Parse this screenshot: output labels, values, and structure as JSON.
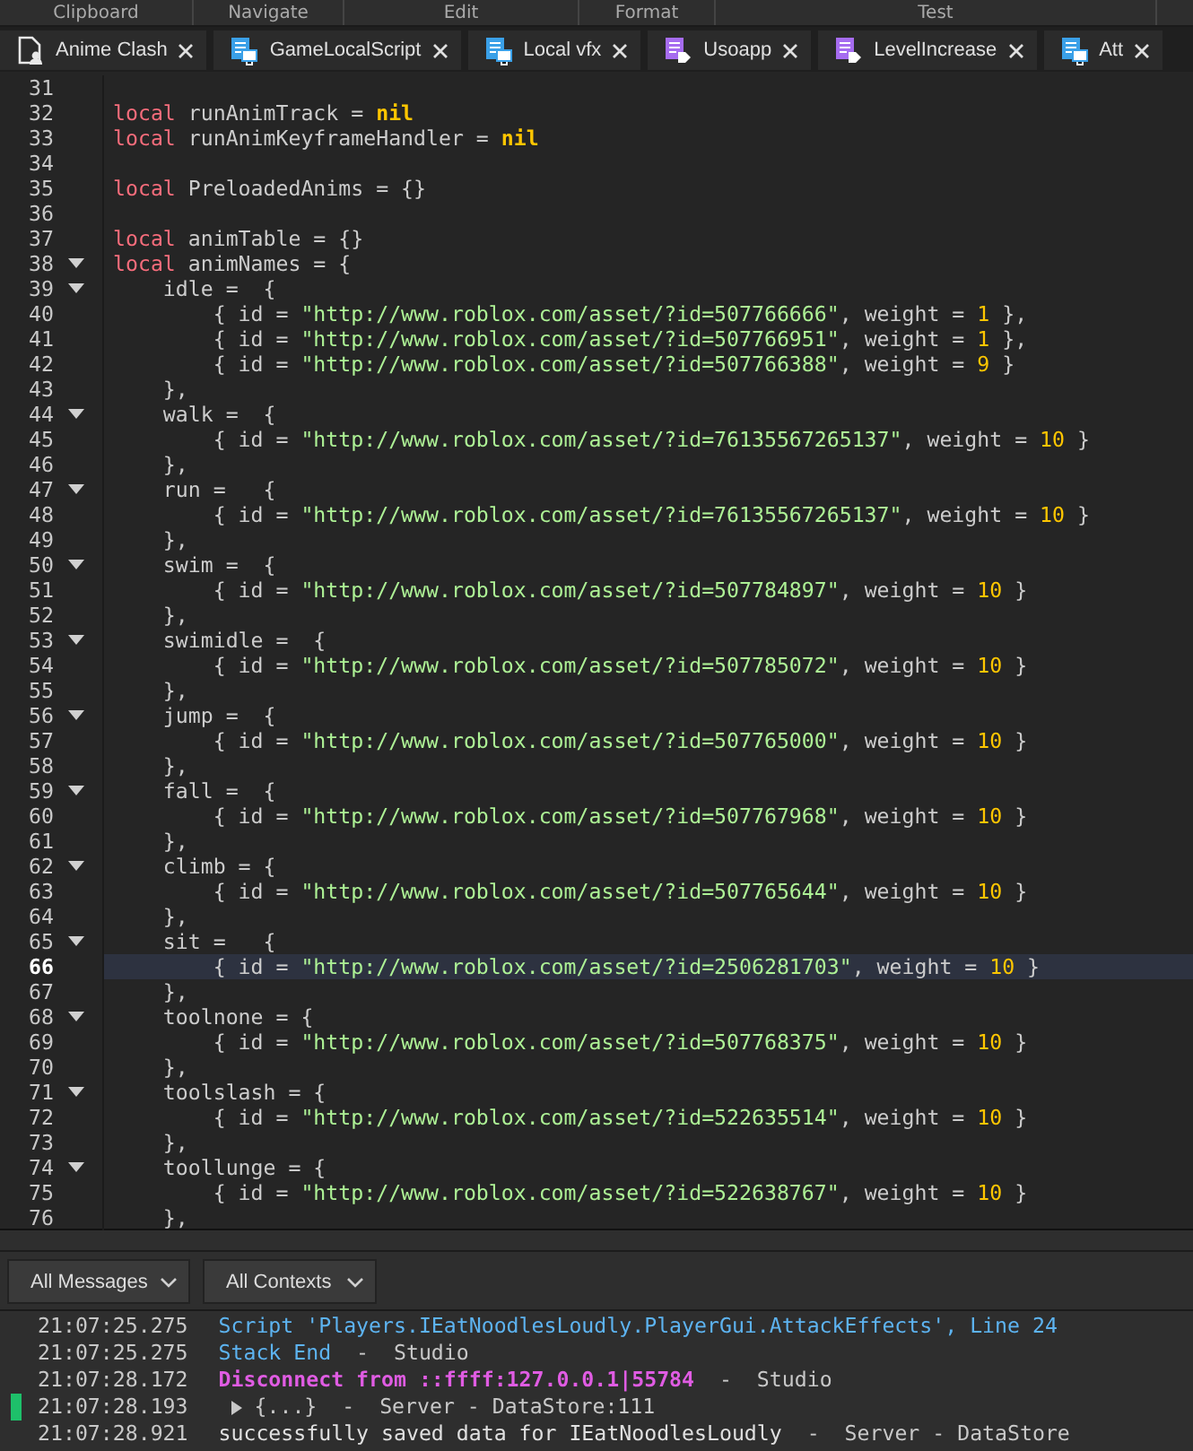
{
  "ribbon": [
    {
      "label": "Clipboard"
    },
    {
      "label": "Navigate"
    },
    {
      "label": "Edit"
    },
    {
      "label": "Format"
    },
    {
      "label": "Test"
    }
  ],
  "tabs": [
    {
      "label": "Anime Clash",
      "kind": "script"
    },
    {
      "label": "GameLocalScript",
      "kind": "local-script"
    },
    {
      "label": "Local vfx",
      "kind": "local-script"
    },
    {
      "label": "Usoapp",
      "kind": "module-script"
    },
    {
      "label": "LevelIncrease",
      "kind": "module-script"
    },
    {
      "label": "Att",
      "kind": "local-script"
    }
  ],
  "editor": {
    "lines": [
      {
        "number": "31",
        "fold": false,
        "current": false
      },
      {
        "number": "32",
        "fold": false,
        "current": false,
        "tokens": [
          {
            "kind": "keyword",
            "text": "local"
          },
          {
            "kind": "plain",
            "text": " runAnimTrack = "
          },
          {
            "kind": "nil",
            "text": "nil"
          }
        ]
      },
      {
        "number": "33",
        "fold": false,
        "current": false,
        "tokens": [
          {
            "kind": "keyword",
            "text": "local"
          },
          {
            "kind": "plain",
            "text": " runAnimKeyframeHandler = "
          },
          {
            "kind": "nil",
            "text": "nil"
          }
        ]
      },
      {
        "number": "34",
        "fold": false,
        "current": false
      },
      {
        "number": "35",
        "fold": false,
        "current": false,
        "tokens": [
          {
            "kind": "keyword",
            "text": "local"
          },
          {
            "kind": "plain",
            "text": " PreloadedAnims = {}"
          }
        ]
      },
      {
        "number": "36",
        "fold": false,
        "current": false
      },
      {
        "number": "37",
        "fold": false,
        "current": false,
        "tokens": [
          {
            "kind": "keyword",
            "text": "local"
          },
          {
            "kind": "plain",
            "text": " animTable = {}"
          }
        ]
      },
      {
        "number": "38",
        "fold": true,
        "current": false,
        "tokens": [
          {
            "kind": "keyword",
            "text": "local"
          },
          {
            "kind": "plain",
            "text": " animNames = {"
          }
        ]
      },
      {
        "number": "39",
        "fold": true,
        "current": false,
        "tokens": [
          {
            "kind": "plain",
            "text": "    idle =  {"
          }
        ]
      },
      {
        "number": "40",
        "fold": false,
        "current": false,
        "tokens": [
          {
            "kind": "plain",
            "text": "        { id = "
          },
          {
            "kind": "string",
            "text": "\"http://www.roblox.com/asset/?id=507766666\""
          },
          {
            "kind": "plain",
            "text": ", weight = "
          },
          {
            "kind": "number",
            "text": "1"
          },
          {
            "kind": "plain",
            "text": " },"
          }
        ]
      },
      {
        "number": "41",
        "fold": false,
        "current": false,
        "tokens": [
          {
            "kind": "plain",
            "text": "        { id = "
          },
          {
            "kind": "string",
            "text": "\"http://www.roblox.com/asset/?id=507766951\""
          },
          {
            "kind": "plain",
            "text": ", weight = "
          },
          {
            "kind": "number",
            "text": "1"
          },
          {
            "kind": "plain",
            "text": " },"
          }
        ]
      },
      {
        "number": "42",
        "fold": false,
        "current": false,
        "tokens": [
          {
            "kind": "plain",
            "text": "        { id = "
          },
          {
            "kind": "string",
            "text": "\"http://www.roblox.com/asset/?id=507766388\""
          },
          {
            "kind": "plain",
            "text": ", weight = "
          },
          {
            "kind": "number",
            "text": "9"
          },
          {
            "kind": "plain",
            "text": " }"
          }
        ]
      },
      {
        "number": "43",
        "fold": false,
        "current": false,
        "tokens": [
          {
            "kind": "plain",
            "text": "    },"
          }
        ]
      },
      {
        "number": "44",
        "fold": true,
        "current": false,
        "tokens": [
          {
            "kind": "plain",
            "text": "    walk =  {"
          }
        ]
      },
      {
        "number": "45",
        "fold": false,
        "current": false,
        "tokens": [
          {
            "kind": "plain",
            "text": "        { id = "
          },
          {
            "kind": "string",
            "text": "\"http://www.roblox.com/asset/?id=76135567265137\""
          },
          {
            "kind": "plain",
            "text": ", weight = "
          },
          {
            "kind": "number",
            "text": "10"
          },
          {
            "kind": "plain",
            "text": " }"
          }
        ]
      },
      {
        "number": "46",
        "fold": false,
        "current": false,
        "tokens": [
          {
            "kind": "plain",
            "text": "    },"
          }
        ]
      },
      {
        "number": "47",
        "fold": true,
        "current": false,
        "tokens": [
          {
            "kind": "plain",
            "text": "    run =   {"
          }
        ]
      },
      {
        "number": "48",
        "fold": false,
        "current": false,
        "tokens": [
          {
            "kind": "plain",
            "text": "        { id = "
          },
          {
            "kind": "string",
            "text": "\"http://www.roblox.com/asset/?id=76135567265137\""
          },
          {
            "kind": "plain",
            "text": ", weight = "
          },
          {
            "kind": "number",
            "text": "10"
          },
          {
            "kind": "plain",
            "text": " }"
          }
        ]
      },
      {
        "number": "49",
        "fold": false,
        "current": false,
        "tokens": [
          {
            "kind": "plain",
            "text": "    },"
          }
        ]
      },
      {
        "number": "50",
        "fold": true,
        "current": false,
        "tokens": [
          {
            "kind": "plain",
            "text": "    swim =  {"
          }
        ]
      },
      {
        "number": "51",
        "fold": false,
        "current": false,
        "tokens": [
          {
            "kind": "plain",
            "text": "        { id = "
          },
          {
            "kind": "string",
            "text": "\"http://www.roblox.com/asset/?id=507784897\""
          },
          {
            "kind": "plain",
            "text": ", weight = "
          },
          {
            "kind": "number",
            "text": "10"
          },
          {
            "kind": "plain",
            "text": " }"
          }
        ]
      },
      {
        "number": "52",
        "fold": false,
        "current": false,
        "tokens": [
          {
            "kind": "plain",
            "text": "    },"
          }
        ]
      },
      {
        "number": "53",
        "fold": true,
        "current": false,
        "tokens": [
          {
            "kind": "plain",
            "text": "    swimidle =  {"
          }
        ]
      },
      {
        "number": "54",
        "fold": false,
        "current": false,
        "tokens": [
          {
            "kind": "plain",
            "text": "        { id = "
          },
          {
            "kind": "string",
            "text": "\"http://www.roblox.com/asset/?id=507785072\""
          },
          {
            "kind": "plain",
            "text": ", weight = "
          },
          {
            "kind": "number",
            "text": "10"
          },
          {
            "kind": "plain",
            "text": " }"
          }
        ]
      },
      {
        "number": "55",
        "fold": false,
        "current": false,
        "tokens": [
          {
            "kind": "plain",
            "text": "    },"
          }
        ]
      },
      {
        "number": "56",
        "fold": true,
        "current": false,
        "tokens": [
          {
            "kind": "plain",
            "text": "    jump =  {"
          }
        ]
      },
      {
        "number": "57",
        "fold": false,
        "current": false,
        "tokens": [
          {
            "kind": "plain",
            "text": "        { id = "
          },
          {
            "kind": "string",
            "text": "\"http://www.roblox.com/asset/?id=507765000\""
          },
          {
            "kind": "plain",
            "text": ", weight = "
          },
          {
            "kind": "number",
            "text": "10"
          },
          {
            "kind": "plain",
            "text": " }"
          }
        ]
      },
      {
        "number": "58",
        "fold": false,
        "current": false,
        "tokens": [
          {
            "kind": "plain",
            "text": "    },"
          }
        ]
      },
      {
        "number": "59",
        "fold": true,
        "current": false,
        "tokens": [
          {
            "kind": "plain",
            "text": "    fall =  {"
          }
        ]
      },
      {
        "number": "60",
        "fold": false,
        "current": false,
        "tokens": [
          {
            "kind": "plain",
            "text": "        { id = "
          },
          {
            "kind": "string",
            "text": "\"http://www.roblox.com/asset/?id=507767968\""
          },
          {
            "kind": "plain",
            "text": ", weight = "
          },
          {
            "kind": "number",
            "text": "10"
          },
          {
            "kind": "plain",
            "text": " }"
          }
        ]
      },
      {
        "number": "61",
        "fold": false,
        "current": false,
        "tokens": [
          {
            "kind": "plain",
            "text": "    },"
          }
        ]
      },
      {
        "number": "62",
        "fold": true,
        "current": false,
        "tokens": [
          {
            "kind": "plain",
            "text": "    climb = {"
          }
        ]
      },
      {
        "number": "63",
        "fold": false,
        "current": false,
        "tokens": [
          {
            "kind": "plain",
            "text": "        { id = "
          },
          {
            "kind": "string",
            "text": "\"http://www.roblox.com/asset/?id=507765644\""
          },
          {
            "kind": "plain",
            "text": ", weight = "
          },
          {
            "kind": "number",
            "text": "10"
          },
          {
            "kind": "plain",
            "text": " }"
          }
        ]
      },
      {
        "number": "64",
        "fold": false,
        "current": false,
        "tokens": [
          {
            "kind": "plain",
            "text": "    },"
          }
        ]
      },
      {
        "number": "65",
        "fold": true,
        "current": false,
        "tokens": [
          {
            "kind": "plain",
            "text": "    sit =   {"
          }
        ]
      },
      {
        "number": "66",
        "fold": false,
        "current": true,
        "tokens": [
          {
            "kind": "plain",
            "text": "        { id = "
          },
          {
            "kind": "string",
            "text": "\"http://www.roblox.com/asset/?id=2506281703\""
          },
          {
            "kind": "plain",
            "text": ", weight = "
          },
          {
            "kind": "number",
            "text": "10"
          },
          {
            "kind": "plain",
            "text": " }"
          }
        ]
      },
      {
        "number": "67",
        "fold": false,
        "current": false,
        "tokens": [
          {
            "kind": "plain",
            "text": "    },"
          }
        ]
      },
      {
        "number": "68",
        "fold": true,
        "current": false,
        "tokens": [
          {
            "kind": "plain",
            "text": "    toolnone = {"
          }
        ]
      },
      {
        "number": "69",
        "fold": false,
        "current": false,
        "tokens": [
          {
            "kind": "plain",
            "text": "        { id = "
          },
          {
            "kind": "string",
            "text": "\"http://www.roblox.com/asset/?id=507768375\""
          },
          {
            "kind": "plain",
            "text": ", weight = "
          },
          {
            "kind": "number",
            "text": "10"
          },
          {
            "kind": "plain",
            "text": " }"
          }
        ]
      },
      {
        "number": "70",
        "fold": false,
        "current": false,
        "tokens": [
          {
            "kind": "plain",
            "text": "    },"
          }
        ]
      },
      {
        "number": "71",
        "fold": true,
        "current": false,
        "tokens": [
          {
            "kind": "plain",
            "text": "    toolslash = {"
          }
        ]
      },
      {
        "number": "72",
        "fold": false,
        "current": false,
        "tokens": [
          {
            "kind": "plain",
            "text": "        { id = "
          },
          {
            "kind": "string",
            "text": "\"http://www.roblox.com/asset/?id=522635514\""
          },
          {
            "kind": "plain",
            "text": ", weight = "
          },
          {
            "kind": "number",
            "text": "10"
          },
          {
            "kind": "plain",
            "text": " }"
          }
        ]
      },
      {
        "number": "73",
        "fold": false,
        "current": false,
        "tokens": [
          {
            "kind": "plain",
            "text": "    },"
          }
        ]
      },
      {
        "number": "74",
        "fold": true,
        "current": false,
        "tokens": [
          {
            "kind": "plain",
            "text": "    toollunge = {"
          }
        ]
      },
      {
        "number": "75",
        "fold": false,
        "current": false,
        "tokens": [
          {
            "kind": "plain",
            "text": "        { id = "
          },
          {
            "kind": "string",
            "text": "\"http://www.roblox.com/asset/?id=522638767\""
          },
          {
            "kind": "plain",
            "text": ", weight = "
          },
          {
            "kind": "number",
            "text": "10"
          },
          {
            "kind": "plain",
            "text": " }"
          }
        ]
      },
      {
        "number": "76",
        "fold": false,
        "current": false,
        "tokens": [
          {
            "kind": "plain",
            "text": "    },"
          }
        ]
      }
    ]
  },
  "output": {
    "filters": [
      {
        "label": "All Messages"
      },
      {
        "label": "All Contexts"
      }
    ],
    "messages": [
      {
        "time": "21:07:25.275",
        "kind": "info",
        "expandable": false,
        "marker": false,
        "parts": [
          {
            "kind": "info",
            "text": "Script 'Players.IEatNoodlesLoudly.PlayerGui.AttackEffects', Line 24"
          }
        ]
      },
      {
        "time": "21:07:25.275",
        "kind": "info",
        "expandable": false,
        "marker": false,
        "parts": [
          {
            "kind": "info",
            "text": "Stack End"
          },
          {
            "kind": "source",
            "text": "  -  Studio"
          }
        ]
      },
      {
        "time": "21:07:28.172",
        "kind": "warning",
        "expandable": false,
        "marker": false,
        "parts": [
          {
            "kind": "alert",
            "text": "Disconnect from ::ffff:127.0.0.1|55784"
          },
          {
            "kind": "source",
            "text": "  -  Studio"
          }
        ]
      },
      {
        "time": "21:07:28.193",
        "kind": "plain",
        "expandable": true,
        "marker": true,
        "parts": [
          {
            "kind": "source",
            "text": "{...}  -  Server - DataStore:111"
          }
        ]
      },
      {
        "time": "21:07:28.921",
        "kind": "plain",
        "expandable": false,
        "marker": false,
        "parts": [
          {
            "kind": "plain",
            "text": "successfully saved data for IEatNoodlesLoudly"
          },
          {
            "kind": "source",
            "text": "  -  Server - DataStore"
          }
        ]
      }
    ]
  }
}
